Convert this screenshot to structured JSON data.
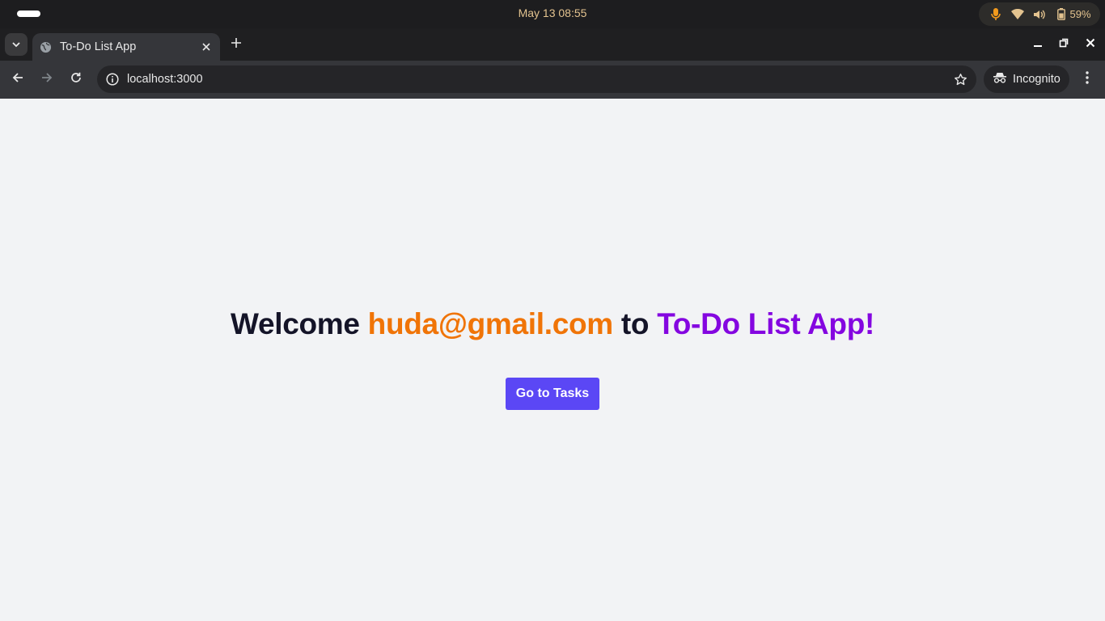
{
  "os": {
    "clock": "May 13  08:55",
    "battery_percent": "59%",
    "icons": [
      "pill-indicator",
      "mic-icon",
      "wifi-icon",
      "volume-icon",
      "battery-icon"
    ]
  },
  "browser": {
    "tab": {
      "title": "To-Do List App",
      "favicon": "globe-icon"
    },
    "url": "localhost:3000",
    "incognito_label": "Incognito"
  },
  "page": {
    "welcome_prefix": "Welcome ",
    "email": "huda@gmail.com",
    "welcome_mid": " to ",
    "app_name": "To-Do List App!",
    "cta_label": "Go to Tasks"
  },
  "colors": {
    "email": "#f07407",
    "app_name": "#8406e0",
    "button": "#5b47f5",
    "heading": "#141428",
    "background": "#f2f3f5"
  }
}
